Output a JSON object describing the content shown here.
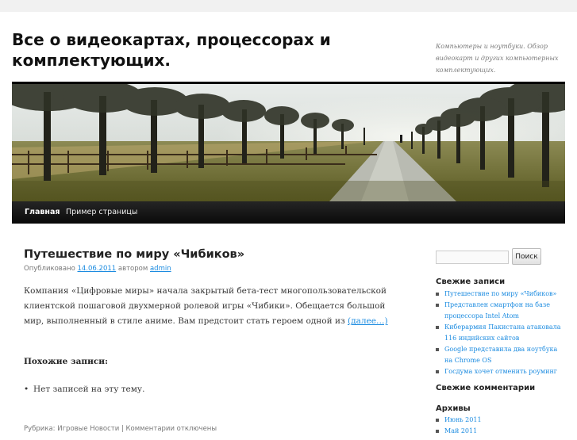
{
  "site": {
    "title": "Все о видеокартах, процессорах и комплектующих.",
    "description": "Компьютеры и ноутбуки. Обзор видеокарт и других компьютерных комплектующих."
  },
  "nav": {
    "items": [
      {
        "label": "Главная",
        "current": true
      },
      {
        "label": "Пример страницы",
        "current": false
      }
    ]
  },
  "post": {
    "title": "Путешествие по миру «Чибиков»",
    "meta_prefix": "Опубликовано",
    "date": "14.06.2011",
    "meta_author_prefix": "автором",
    "author": "admin",
    "body": "Компания «Цифровые миры» начала закрытый бета-тест многопользовательской клиентской пошаговой двухмерной ролевой игры «Чибики». Обещается большой мир, выполненный в стиле аниме. Вам предстоит стать героем одной из",
    "more_link": "(далее…)",
    "related_title": "Похожие записи:",
    "related_empty": "Нет записей на эту тему.",
    "footer": "Рубрика: Игровые Новости | Комментарии отключены"
  },
  "sidebar": {
    "search_placeholder": "",
    "search_button": "Поиск",
    "recent_posts_title": "Свежие записи",
    "recent_posts": [
      "Путешествие по миру «Чибиков»",
      "Представлен смартфон на базе процессора Intel Atom",
      "Кибер­армия Пакистана атаковала 116 индийских сайтов",
      "Google представила два ноутбука на Chrome OS",
      "Госдума хочет отменить роуминг"
    ],
    "recent_comments_title": "Свежие комментарии",
    "archives_title": "Архивы",
    "archives": [
      "Июнь 2011",
      "Май 2011"
    ]
  },
  "colors": {
    "link": "#1b8be0",
    "nav_bg": "#111111",
    "page_bg": "#f1f1f1"
  }
}
